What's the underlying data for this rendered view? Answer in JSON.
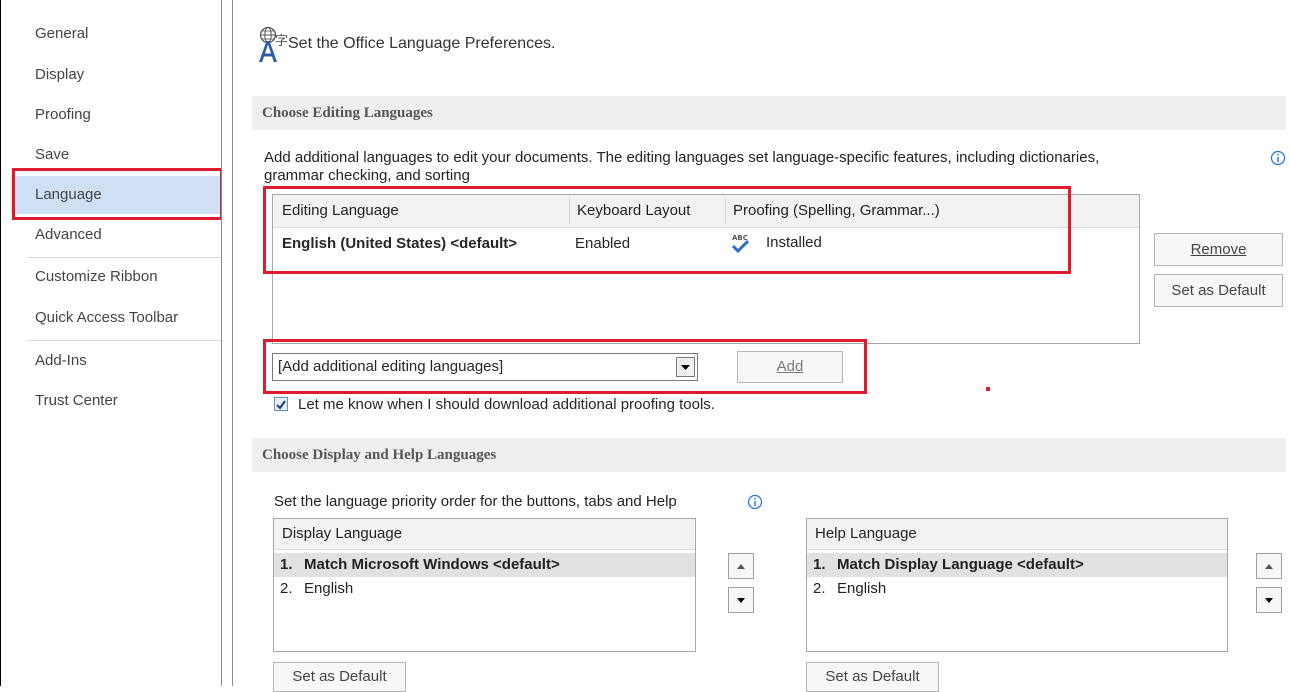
{
  "sidebar": {
    "items": [
      {
        "label": "General"
      },
      {
        "label": "Display"
      },
      {
        "label": "Proofing"
      },
      {
        "label": "Save"
      },
      {
        "label": "Language"
      },
      {
        "label": "Advanced"
      },
      {
        "label": "Customize Ribbon"
      },
      {
        "label": "Quick Access Toolbar"
      },
      {
        "label": "Add-Ins"
      },
      {
        "label": "Trust Center"
      }
    ],
    "selected": "Language"
  },
  "header": {
    "title": "Set the Office Language Preferences.",
    "icon": "language-globe-icon"
  },
  "editing": {
    "section_title": "Choose Editing Languages",
    "description_line1": "Add additional languages to edit your documents. The editing languages set language-specific features, including dictionaries,",
    "description_line2": "grammar checking, and sorting",
    "columns": [
      "Editing Language",
      "Keyboard Layout",
      "Proofing (Spelling, Grammar...)"
    ],
    "rows": [
      {
        "language": "English (United States) <default>",
        "keyboard": "Enabled",
        "proofing": "Installed",
        "proofing_icon_text": "ABC"
      }
    ],
    "remove_label": "Remove",
    "set_default_label": "Set as Default",
    "dropdown_value": "[Add additional editing languages]",
    "add_label": "Add",
    "proofing_tools_checkbox": {
      "label": "Let me know when I should download additional proofing tools.",
      "checked": true
    }
  },
  "display_help": {
    "section_title": "Choose Display and Help Languages",
    "description": "Set the language priority order for the buttons, tabs and Help",
    "display_list": {
      "header": "Display Language",
      "items": [
        {
          "num": "1.",
          "label": "Match Microsoft Windows <default>",
          "selected": true
        },
        {
          "num": "2.",
          "label": "English",
          "selected": false
        }
      ]
    },
    "help_list": {
      "header": "Help Language",
      "items": [
        {
          "num": "1.",
          "label": "Match Display Language <default>",
          "selected": true
        },
        {
          "num": "2.",
          "label": "English",
          "selected": false
        }
      ]
    },
    "set_default_label": "Set as Default"
  },
  "colors": {
    "highlight": "#e01b2b",
    "selected_nav": "#cfe0f4",
    "info_icon": "#1e73d6"
  }
}
